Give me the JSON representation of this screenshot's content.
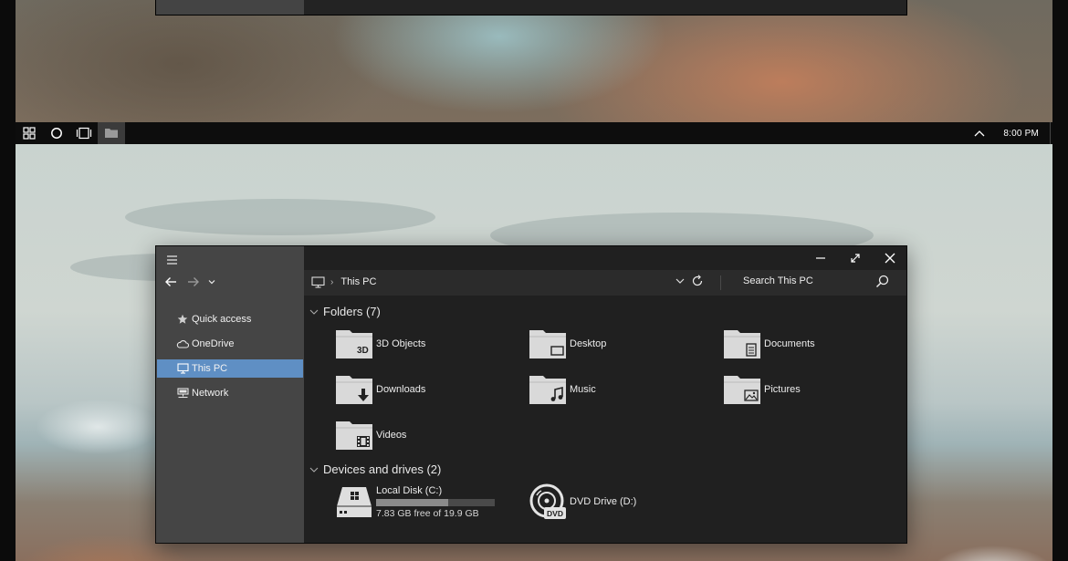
{
  "taskbar": {
    "clock": "8:00 PM",
    "buttons": [
      "start-icon",
      "cortana-icon",
      "task-view-icon",
      "file-explorer-icon"
    ]
  },
  "explorer": {
    "sidebar": {
      "items": [
        {
          "label": "Quick access",
          "icon": "star-icon"
        },
        {
          "label": "OneDrive",
          "icon": "cloud-icon"
        },
        {
          "label": "This PC",
          "icon": "computer-icon",
          "selected": true
        },
        {
          "label": "Network",
          "icon": "network-icon"
        }
      ]
    },
    "address": {
      "location": "This PC"
    },
    "search": {
      "placeholder": "Search This PC"
    },
    "folders": {
      "heading": "Folders (7)",
      "items": [
        {
          "label": "3D Objects",
          "glyph": "3D"
        },
        {
          "label": "Desktop",
          "glyph": "desktop"
        },
        {
          "label": "Documents",
          "glyph": "document"
        },
        {
          "label": "Downloads",
          "glyph": "download"
        },
        {
          "label": "Music",
          "glyph": "music"
        },
        {
          "label": "Pictures",
          "glyph": "picture"
        },
        {
          "label": "Videos",
          "glyph": "film"
        }
      ]
    },
    "devices": {
      "heading": "Devices and drives (2)",
      "items": [
        {
          "label": "Local Disk (C:)",
          "free_text": "7.83 GB free of 19.9 GB",
          "used_fraction": 0.61
        },
        {
          "label": "DVD Drive (D:)",
          "badge": "DVD"
        }
      ]
    }
  }
}
